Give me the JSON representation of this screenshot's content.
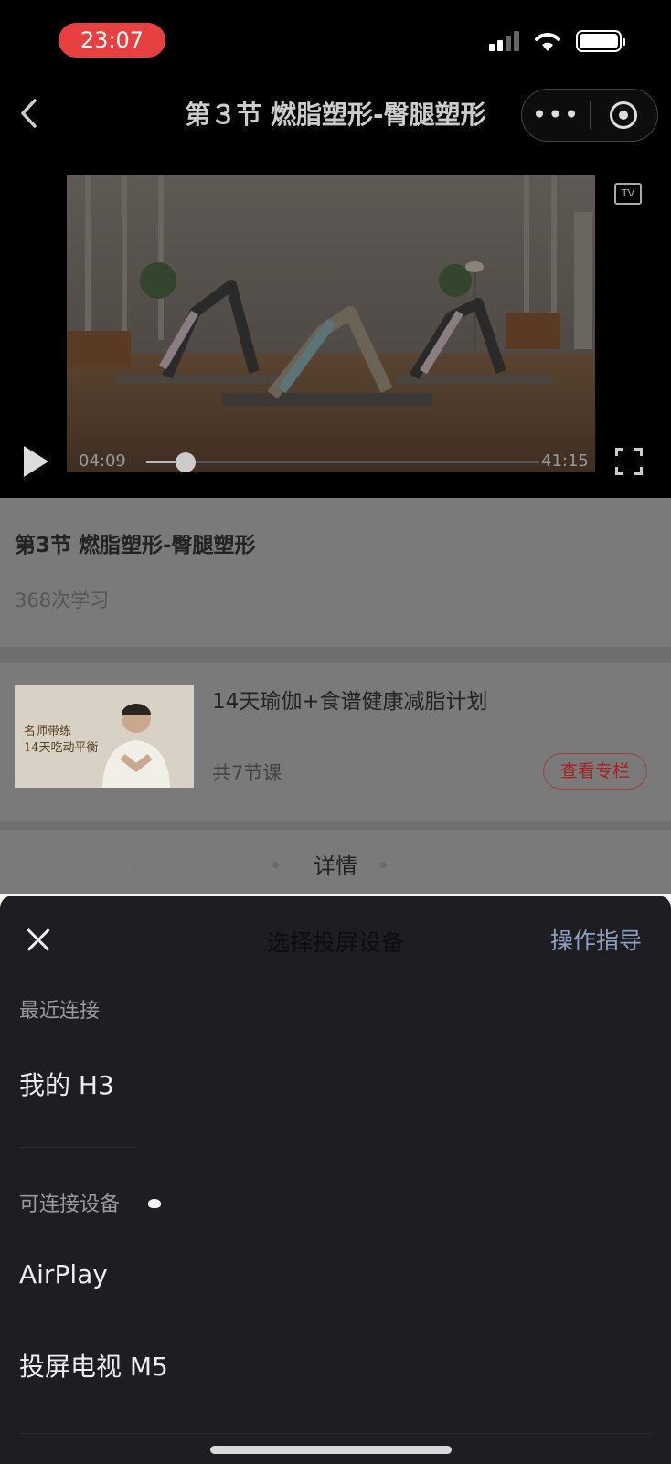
{
  "status_bar": {
    "time": "23:07"
  },
  "nav": {
    "title": "第３节 燃脂塑形-臀腿塑形",
    "more_glyph": "•••"
  },
  "video": {
    "tv_label": "TV",
    "current_time": "04:09",
    "total_time": "41:15",
    "progress_fraction": 0.1
  },
  "lesson": {
    "title": "第3节 燃脂塑形-臀腿塑形",
    "study_count": "368次学习"
  },
  "course": {
    "title": "14天瑜伽+食谱健康减脂计划",
    "lesson_count": "共7节课",
    "view_button": "查看专栏",
    "thumb_text_line1": "名师带练",
    "thumb_text_line2": "14天吃动平衡"
  },
  "detail": {
    "label": "详情"
  },
  "sheet": {
    "title": "选择投屏设备",
    "guide": "操作指导",
    "recent_label": "最近连接",
    "recent_devices": [
      "我的 H3"
    ],
    "available_label": "可连接设备",
    "available_devices": [
      "AirPlay",
      "投屏电视 M5"
    ]
  }
}
